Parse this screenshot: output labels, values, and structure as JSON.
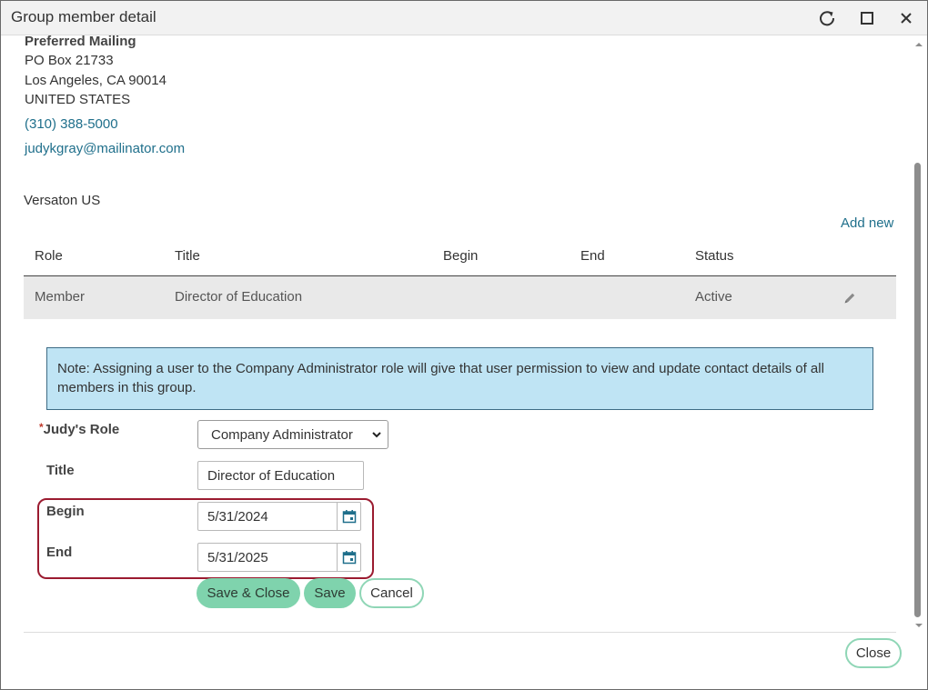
{
  "window": {
    "title": "Group member detail",
    "controls": [
      "refresh-icon",
      "maximize-icon",
      "close-icon"
    ]
  },
  "address": {
    "label": "Preferred Mailing",
    "line1": "PO Box 21733",
    "line2": "Los Angeles, CA 90014",
    "line3": "UNITED STATES",
    "phone": "(310) 388-5000",
    "email": "judykgray@mailinator.com"
  },
  "organization": {
    "name": "Versaton US",
    "add_new": "Add new"
  },
  "table": {
    "headers": {
      "role": "Role",
      "title": "Title",
      "begin": "Begin",
      "end": "End",
      "status": "Status"
    },
    "rows": [
      {
        "role": "Member",
        "title": "Director of Education",
        "begin": "",
        "end": "",
        "status": "Active",
        "action_icon": "pencil-icon"
      }
    ]
  },
  "note": "Note: Assigning a user to the Company Administrator role will give that user permission to view and update contact details of all members in this group.",
  "form": {
    "role_label": "Judy's Role",
    "role_required_marker": "*",
    "role_value": "Company Administrator",
    "title_label": "Title",
    "title_value": "Director of Education",
    "begin_label": "Begin",
    "begin_value": "5/31/2024",
    "end_label": "End",
    "end_value": "5/31/2025"
  },
  "buttons": {
    "save_close": "Save & Close",
    "save": "Save",
    "cancel": "Cancel",
    "close": "Close"
  },
  "colors": {
    "link": "#1f6f8b",
    "primary_button": "#7fd3ad",
    "note_background": "#bfe4f4",
    "highlight_border": "#9b1b30",
    "required": "#c0392b"
  }
}
